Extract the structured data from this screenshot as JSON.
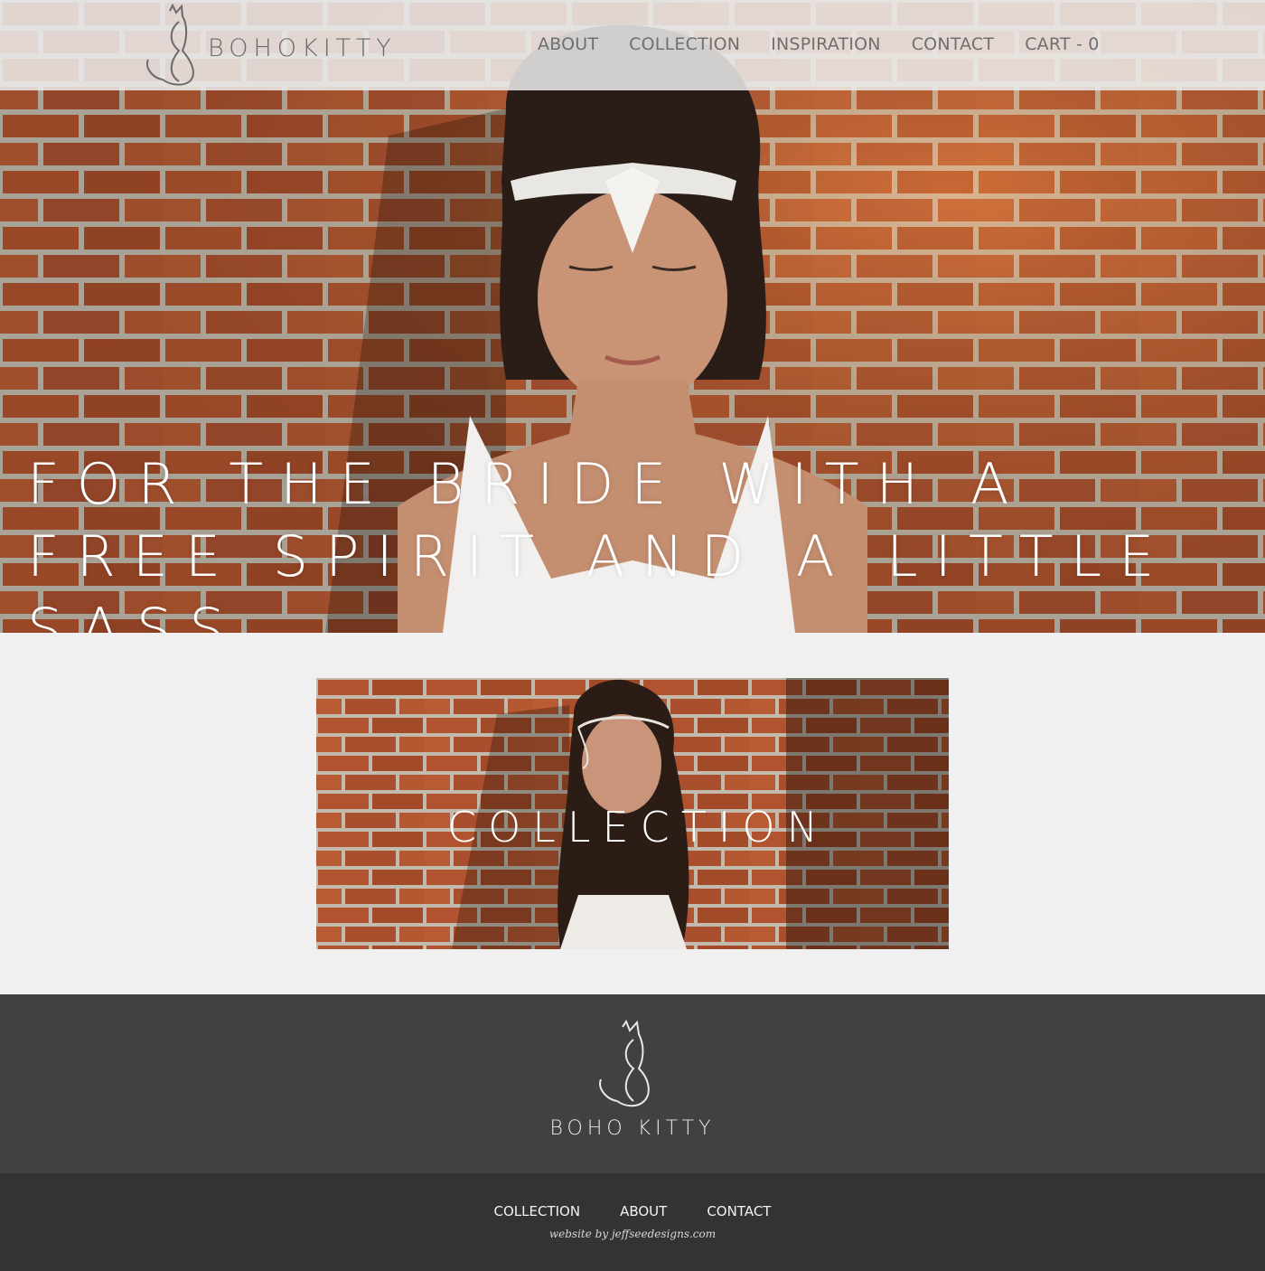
{
  "header": {
    "brand": "BOHOKITTY",
    "nav": [
      {
        "label": "ABOUT"
      },
      {
        "label": "COLLECTION"
      },
      {
        "label": "INSPIRATION"
      },
      {
        "label": "CONTACT"
      },
      {
        "label": "CART - 0"
      }
    ]
  },
  "hero": {
    "headline": "FOR THE BRIDE WITH A FREE SPIRIT AND A LITTLE SASS",
    "image": "bride-with-jeweled-headpiece-against-brick-wall"
  },
  "collection": {
    "label": "COLLECTION",
    "image": "bride-with-chain-headpiece-against-brick-wall"
  },
  "footer": {
    "brand": "BOHO KITTY",
    "nav": [
      {
        "label": "COLLECTION"
      },
      {
        "label": "ABOUT"
      },
      {
        "label": "CONTACT"
      }
    ],
    "credit": "website by jeffseedesigns.com"
  },
  "colors": {
    "header_bg": "#ececec",
    "brick": "#b0552f",
    "footer_brand_bg": "#414141",
    "footer_bottom_bg": "#333333",
    "page_bg": "#f0f0f0"
  }
}
